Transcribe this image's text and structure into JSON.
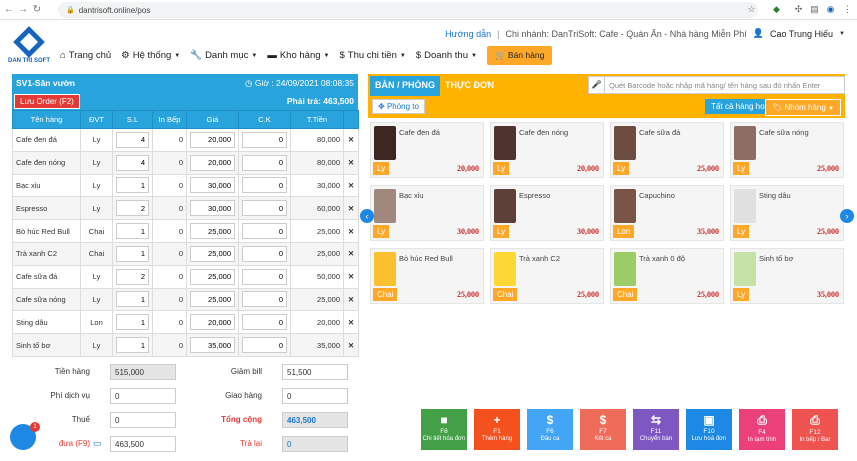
{
  "browser": {
    "url": "dantrisoft.online/pos"
  },
  "header": {
    "logo_text": "DAN TRI SOFT",
    "help": "Hướng dẫn",
    "branch": "Chi nhánh: DanTriSoft: Cafe - Quán Ăn - Nhà hàng Miễn Phí",
    "user": "Cao Trung Hiếu",
    "menu": [
      "Trang chủ",
      "Hệ thống",
      "Danh mục",
      "Kho hàng",
      "Thu chi tiền",
      "Doanh thu"
    ],
    "sell_label": "Bán hàng"
  },
  "order": {
    "table_name": "SV1-Sân vườn",
    "time": "Giờ : 24/09/2021 08:08:35",
    "save_label": "Lưu Order (F2)",
    "total_pay": "Phải trả: 463,500",
    "columns": [
      "Tên hàng",
      "ĐVT",
      "S.L",
      "In Bếp",
      "Giá",
      "C.K",
      "T.Tiền"
    ],
    "rows": [
      {
        "name": "Cafe đen đá",
        "unit": "Ly",
        "qty": "4",
        "kitchen": "0",
        "price": "20,000",
        "discount": "0",
        "total": "80,000"
      },
      {
        "name": "Cafe đen nóng",
        "unit": "Ly",
        "qty": "4",
        "kitchen": "0",
        "price": "20,000",
        "discount": "0",
        "total": "80,000"
      },
      {
        "name": "Bạc xỉu",
        "unit": "Ly",
        "qty": "1",
        "kitchen": "0",
        "price": "30,000",
        "discount": "0",
        "total": "30,000"
      },
      {
        "name": "Espresso",
        "unit": "Ly",
        "qty": "2",
        "kitchen": "0",
        "price": "30,000",
        "discount": "0",
        "total": "60,000"
      },
      {
        "name": "Bò húc Red Bull",
        "unit": "Chai",
        "qty": "1",
        "kitchen": "0",
        "price": "25,000",
        "discount": "0",
        "total": "25,000"
      },
      {
        "name": "Trà xanh C2",
        "unit": "Chai",
        "qty": "1",
        "kitchen": "0",
        "price": "25,000",
        "discount": "0",
        "total": "25,000"
      },
      {
        "name": "Cafe sữa đá",
        "unit": "Ly",
        "qty": "2",
        "kitchen": "0",
        "price": "25,000",
        "discount": "0",
        "total": "50,000"
      },
      {
        "name": "Cafe sữa nóng",
        "unit": "Ly",
        "qty": "1",
        "kitchen": "0",
        "price": "25,000",
        "discount": "0",
        "total": "25,000"
      },
      {
        "name": "Sting dâu",
        "unit": "Lon",
        "qty": "1",
        "kitchen": "0",
        "price": "20,000",
        "discount": "0",
        "total": "20,000"
      },
      {
        "name": "Sinh tố bơ",
        "unit": "Ly",
        "qty": "1",
        "kitchen": "0",
        "price": "35,000",
        "discount": "0",
        "total": "35,000"
      }
    ]
  },
  "totals": {
    "subtotal_label": "Tiền hàng",
    "subtotal": "515,000",
    "service_label": "Phí dịch vụ",
    "service": "0",
    "tax_label": "Thuế",
    "tax": "0",
    "paid_label": "đưa (F9)",
    "paid": "463,500",
    "discount_label": "Giảm bill",
    "discount": "51,500",
    "delivery_label": "Giao hàng",
    "delivery": "0",
    "grand_label": "Tổng cộng",
    "grand": "463,500",
    "change_label": "Trả lại",
    "change": "0",
    "chat_badge": "1"
  },
  "menu_panel": {
    "tab_tables": "BÀN / PHÒNG",
    "tab_menu": "THỰC ĐƠN",
    "search_placeholder": "Quét Barcode hoặc nhập mã hàng/ tên hàng sau đó nhấn Enter",
    "room_btn": "Phóng to",
    "all_btn": "Tất cả hàng hoá",
    "group_btn": "Nhóm hàng",
    "products": [
      {
        "name": "Cafe đen đá",
        "unit": "Ly",
        "price": "20,000",
        "color": "#3e2723"
      },
      {
        "name": "Cafe đen nóng",
        "unit": "Ly",
        "price": "20,000",
        "color": "#4e342e"
      },
      {
        "name": "Cafe sữa đá",
        "unit": "Ly",
        "price": "25,000",
        "color": "#6d4c41"
      },
      {
        "name": "Cafe sữa nóng",
        "unit": "Ly",
        "price": "25,000",
        "color": "#8d6e63"
      },
      {
        "name": "Bạc xỉu",
        "unit": "Ly",
        "price": "30,000",
        "color": "#a1887f"
      },
      {
        "name": "Espresso",
        "unit": "Ly",
        "price": "30,000",
        "color": "#5d4037"
      },
      {
        "name": "Capuchino",
        "unit": "Lon",
        "price": "35,000",
        "color": "#795548"
      },
      {
        "name": "Sting dâu",
        "unit": "Ly",
        "price": "25,000",
        "color": "#e0e0e0"
      },
      {
        "name": "Bò húc Red Bull",
        "unit": "Chai",
        "price": "25,000",
        "color": "#fbc02d"
      },
      {
        "name": "Trà xanh C2",
        "unit": "Chai",
        "price": "25,000",
        "color": "#fdd835"
      },
      {
        "name": "Trà xanh 0 độ",
        "unit": "Chai",
        "price": "25,000",
        "color": "#9ccc65"
      },
      {
        "name": "Sinh tố bơ",
        "unit": "Ly",
        "price": "35,000",
        "color": "#c5e1a5"
      }
    ]
  },
  "functions": [
    {
      "icon": "■",
      "key": "F8",
      "label": "Chi tiết hóa đơn",
      "color": "#43a047"
    },
    {
      "icon": "+",
      "key": "F1",
      "label": "Thêm hàng",
      "color": "#f4511e"
    },
    {
      "icon": "$",
      "key": "F6",
      "label": "Đầu ca",
      "color": "#42a5f5"
    },
    {
      "icon": "$",
      "key": "F7",
      "label": "Kết ca",
      "color": "#ef6c5a"
    },
    {
      "icon": "⇆",
      "key": "F11",
      "label": "Chuyển bàn",
      "color": "#7e57c2"
    },
    {
      "icon": "▣",
      "key": "F10",
      "label": "Lưu hoá đơn",
      "color": "#1e88e5"
    },
    {
      "icon": "⎙",
      "key": "F4",
      "label": "In tạm tính",
      "color": "#ec407a"
    },
    {
      "icon": "⎙",
      "key": "F12",
      "label": "In bếp / Bar",
      "color": "#ef5350"
    }
  ]
}
